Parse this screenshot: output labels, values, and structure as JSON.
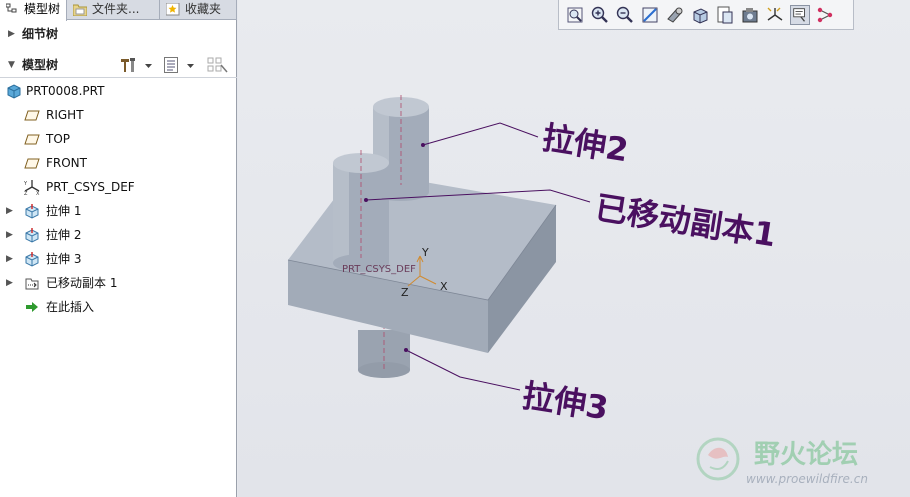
{
  "tabs": [
    {
      "label": "模型树",
      "active": true
    },
    {
      "label": "文件夹...",
      "active": false
    },
    {
      "label": "收藏夹",
      "active": false
    }
  ],
  "detail_tree": {
    "label": "细节树"
  },
  "model_tree": {
    "label": "模型树",
    "items": [
      {
        "label": "PRT0008.PRT",
        "icon": "part-icon",
        "expandable": false
      },
      {
        "label": "RIGHT",
        "icon": "datum-plane-icon",
        "expandable": false
      },
      {
        "label": "TOP",
        "icon": "datum-plane-icon",
        "expandable": false
      },
      {
        "label": "FRONT",
        "icon": "datum-plane-icon",
        "expandable": false
      },
      {
        "label": "PRT_CSYS_DEF",
        "icon": "coordinate-system-icon",
        "expandable": false
      },
      {
        "label": "拉伸 1",
        "icon": "extrude-icon",
        "expandable": true
      },
      {
        "label": "拉伸 2",
        "icon": "extrude-icon",
        "expandable": true
      },
      {
        "label": "拉伸 3",
        "icon": "extrude-icon",
        "expandable": true
      },
      {
        "label": "已移动副本 1",
        "icon": "moved-copy-icon",
        "expandable": true
      },
      {
        "label": "在此插入",
        "icon": "insert-here-arrow-icon",
        "expandable": false
      }
    ]
  },
  "viewport": {
    "csys_label": "PRT_CSYS_DEF",
    "axis_x": "X",
    "axis_y": "Y",
    "axis_z": "Z",
    "annotations": {
      "a1": "拉伸2",
      "a2": "已移动副本1",
      "a3": "拉伸3"
    }
  },
  "watermark": {
    "title": "野火论坛",
    "url": "www.proewildfire.cn"
  },
  "colors": {
    "annotation": "#4a1060",
    "model_face_top": "#b8c0cc",
    "model_face_front": "#a4adba",
    "model_face_side": "#8c96a4",
    "background": "#e6e8ed"
  }
}
